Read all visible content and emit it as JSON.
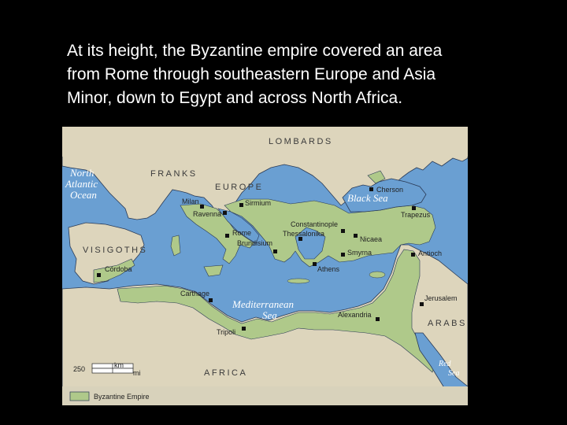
{
  "caption": {
    "line1": "At its height, the Byzantine empire covered an area",
    "line2": "from Rome through southeastern Europe and Asia",
    "line3": "Minor, down to Egypt and across North Africa."
  },
  "map": {
    "colors": {
      "water": "#6a9fd2",
      "land": "#ddd5bc",
      "empire": "#afc98a",
      "coast": "#2a3a55"
    },
    "regions": {
      "lombards": "LOMBARDS",
      "franks": "FRANKS",
      "europe": "EUROPE",
      "visigoths": "VISIGOTHS",
      "africa": "AFRICA",
      "arabs": "ARABS"
    },
    "seas": {
      "atlantic_1": "North",
      "atlantic_2": "Atlantic",
      "atlantic_3": "Ocean",
      "black_sea": "Black Sea",
      "med_1": "Mediterranean",
      "med_2": "Sea",
      "red_1": "Red",
      "red_2": "Sea"
    },
    "cities": {
      "cherson": "Cherson",
      "milan": "Milan",
      "sirmium": "Sirmium",
      "ravenna": "Ravenna",
      "trapezus": "Trapezus",
      "constantinople": "Constantinople",
      "thessalonika": "Thessalonika",
      "rome": "Rome",
      "brundisium": "Brundisium",
      "nicaea": "Nicaea",
      "smyrna": "Smyrna",
      "antioch": "Antioch",
      "cordoba": "Córdoba",
      "athens": "Athens",
      "carthage": "Carthage",
      "jerusalem": "Jerusalem",
      "alexandria": "Alexandria",
      "tripoli": "Tripoli"
    },
    "scale": {
      "value": "250",
      "unit_top": "km",
      "unit_bottom": "mi"
    },
    "legend": {
      "label": "Byzantine Empire"
    }
  }
}
